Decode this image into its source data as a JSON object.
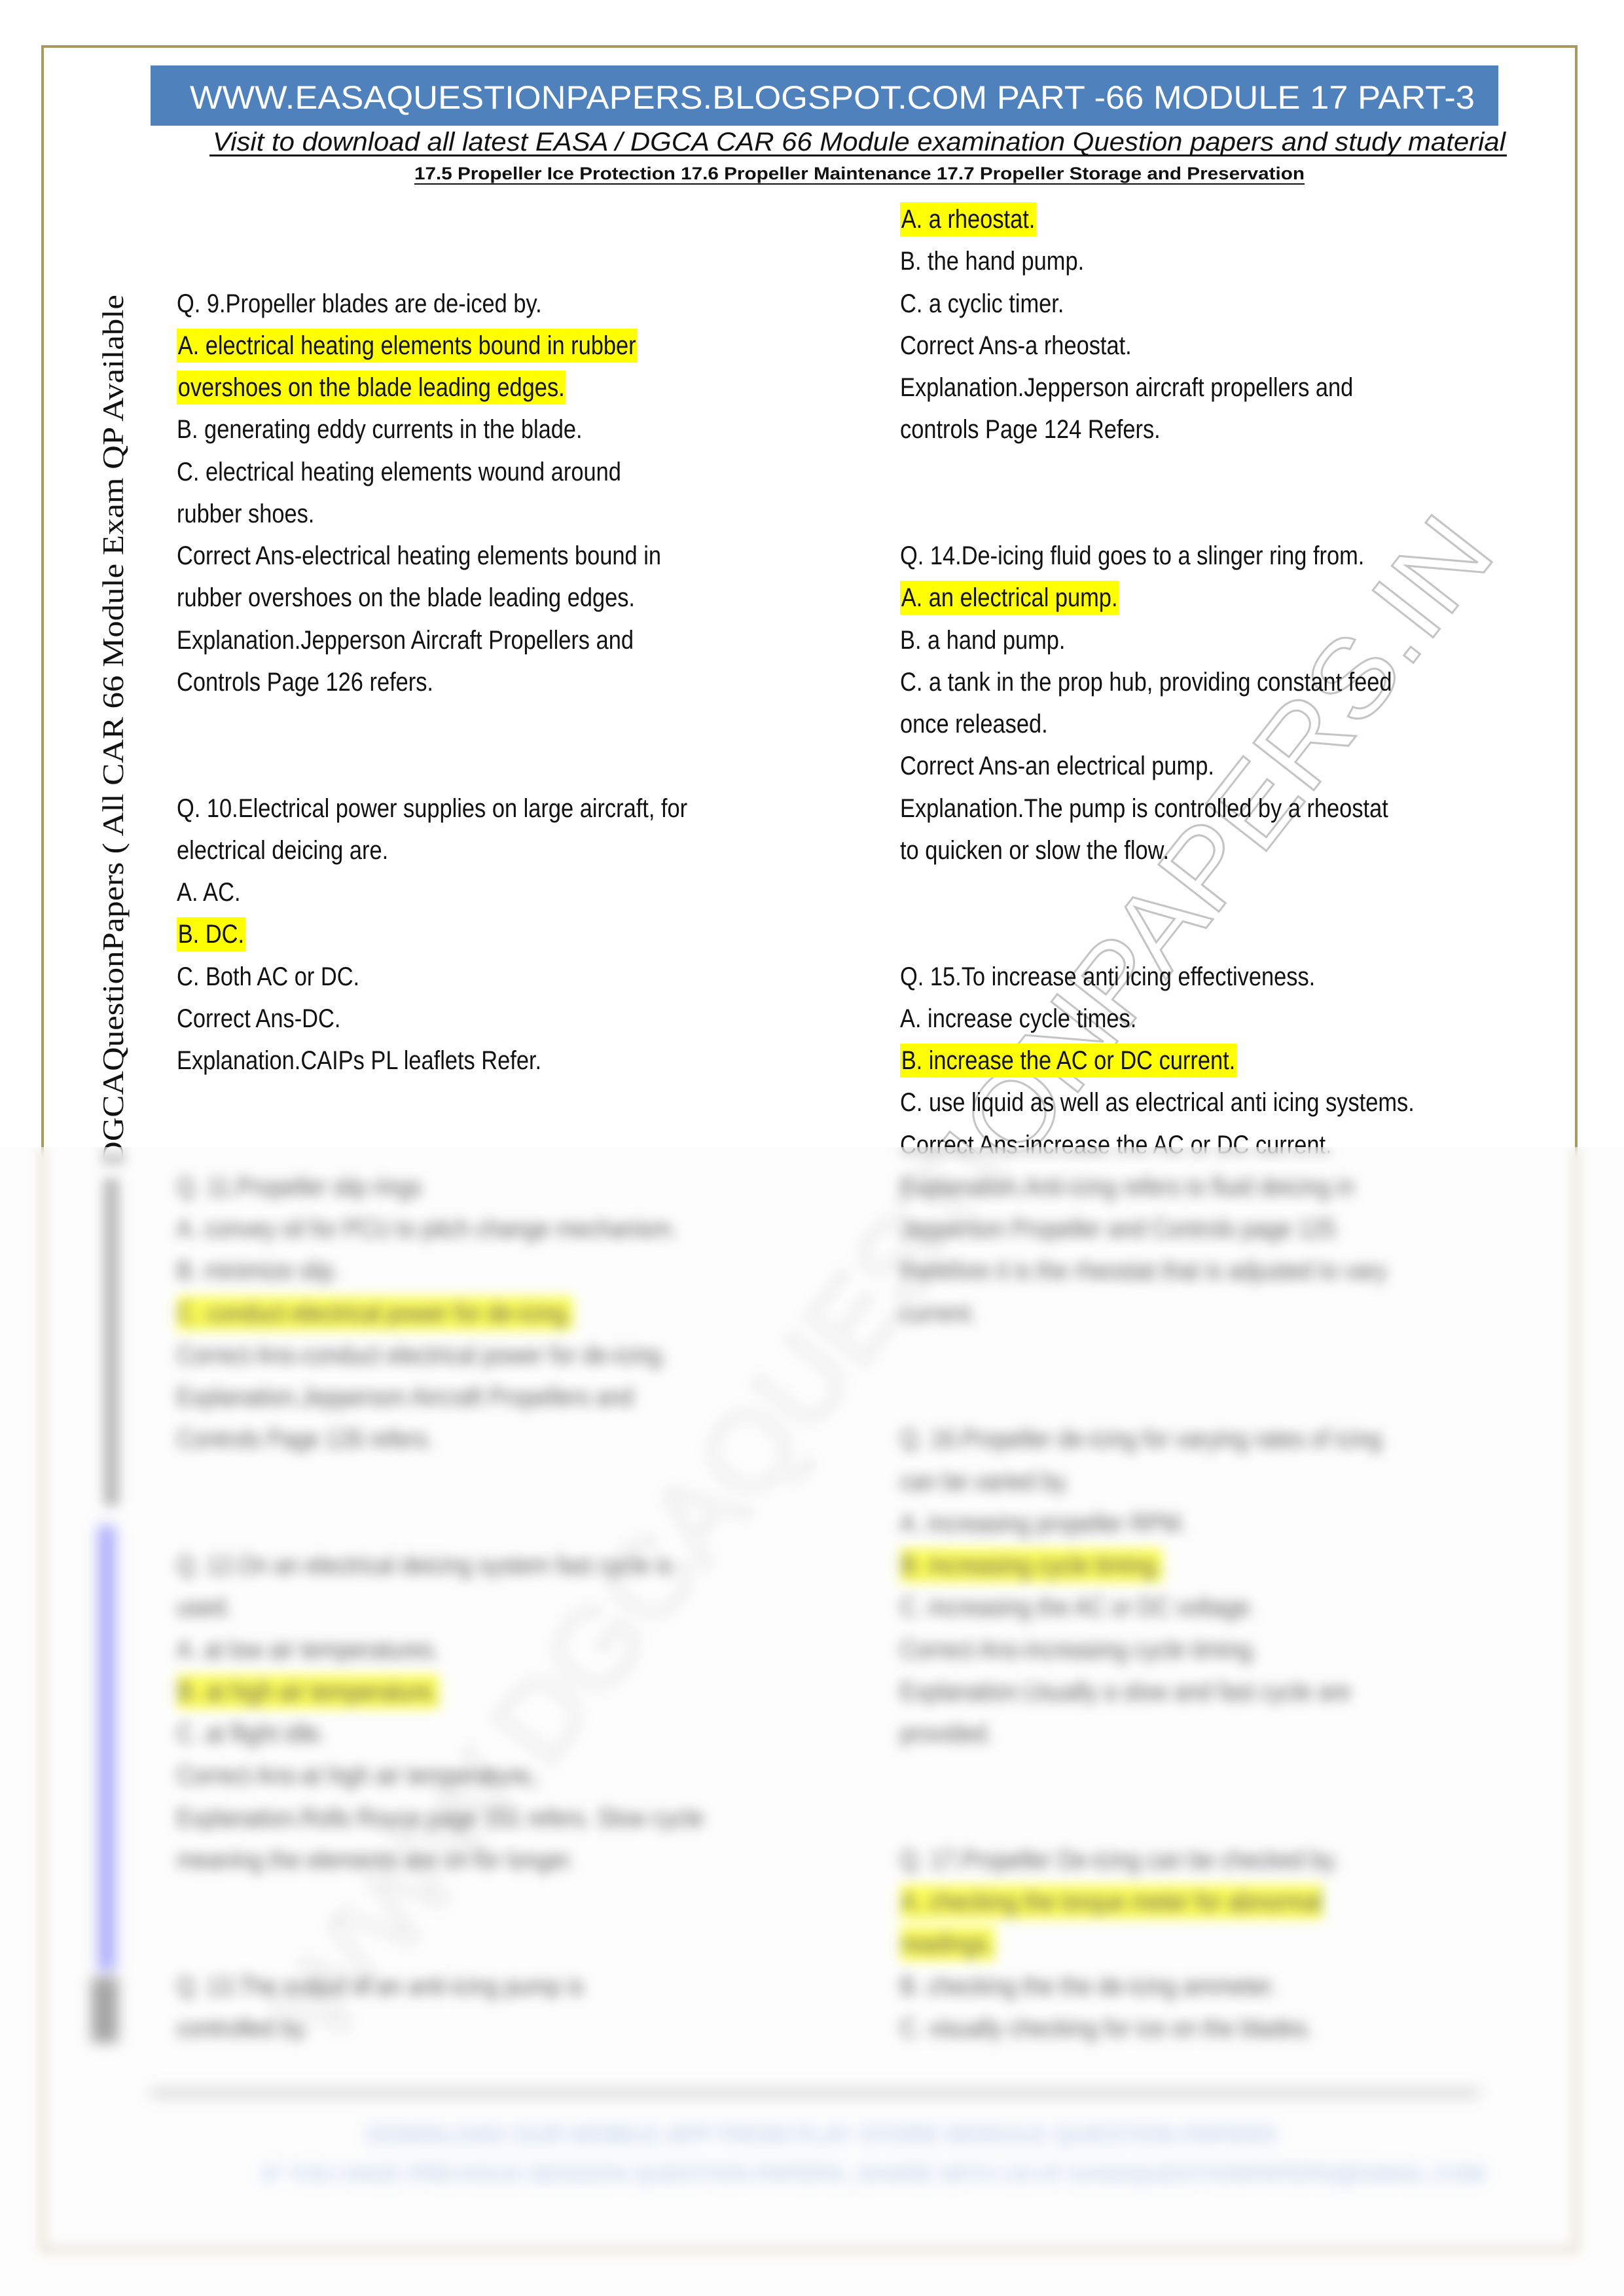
{
  "header": {
    "banner": "WWW.EASAQUESTIONPAPERS.BLOGSPOT.COM PART -66 MODULE 17 PART-3",
    "banner_color": "#4f81bd",
    "visit_line": "Visit to download all latest EASA / DGCA CAR 66 Module examination Question papers and study material",
    "topics": "17.5 Propeller Ice Protection 17.6 Propeller Maintenance 17.7 Propeller Storage and Preservation"
  },
  "sidebar_text": "DGCAQuestionPapers ( All CAR 66 Module Exam QP Available",
  "watermark": "WWW.DGCAQUESTIONPAPERS.IN",
  "highlight_color": "#ffff00",
  "left_column": [
    {
      "lines": [
        {
          "text": "Q. 9.Propeller blades are de-iced by."
        },
        {
          "text": "A. electrical heating elements bound in rubber",
          "hl": true
        },
        {
          "text": "overshoes on the blade leading edges.",
          "hl": true
        },
        {
          "text": "B. generating eddy currents in the blade."
        },
        {
          "text": "C. electrical heating elements wound around"
        },
        {
          "text": "rubber shoes."
        },
        {
          "text": "Correct Ans-electrical heating elements bound in"
        },
        {
          "text": "rubber overshoes on the blade leading edges."
        },
        {
          "text": "Explanation.Jepperson Aircraft Propellers and"
        },
        {
          "text": "Controls Page 126 refers."
        }
      ]
    },
    {
      "lines": [
        {
          "text": "Q. 10.Electrical power supplies on large aircraft, for"
        },
        {
          "text": "electrical deicing are."
        },
        {
          "text": "A. AC."
        },
        {
          "text": "B. DC.",
          "hl": true
        },
        {
          "text": "C. Both AC or DC."
        },
        {
          "text": "Correct Ans-DC."
        },
        {
          "text": "Explanation.CAIPs PL leaflets Refer."
        }
      ]
    },
    {
      "lines": [
        {
          "text": "Q. 11.Propeller slip rings"
        },
        {
          "text": "A. convey oil for PCU to pitch change mechanism."
        },
        {
          "text": "B. minimize slip."
        },
        {
          "text": "C. conduct electrical power for de-icing.",
          "hl": true
        },
        {
          "text": "Correct Ans-conduct electrical power for de-icing."
        },
        {
          "text": "Explanation.Jepperson Aircraft Propellers and"
        },
        {
          "text": "Controls Page 126 refers."
        }
      ]
    },
    {
      "lines": [
        {
          "text": "Q. 12.On an electrical deicing system fast cycle is"
        },
        {
          "text": "used."
        },
        {
          "text": "A. at low air temperatures."
        },
        {
          "text": "B. at high air temperature.",
          "hl": true
        },
        {
          "text": "C. at flight idle."
        },
        {
          "text": "Correct Ans-at high air temperature."
        },
        {
          "text": "Explanation.Rolls Royce page 151 refers. Slow cycle"
        },
        {
          "text": "meaning the elements are on for longer."
        }
      ]
    },
    {
      "lines": [
        {
          "text": "Q. 13.The output of an anti-icing pump is"
        },
        {
          "text": "controlled by."
        }
      ]
    }
  ],
  "right_column": [
    {
      "lines": [
        {
          "text": "A. a rheostat.",
          "hl": true
        },
        {
          "text": "B. the hand pump."
        },
        {
          "text": "C. a cyclic timer."
        },
        {
          "text": "Correct Ans-a rheostat."
        },
        {
          "text": "Explanation.Jepperson aircraft propellers and"
        },
        {
          "text": "controls Page 124 Refers."
        }
      ]
    },
    {
      "lines": [
        {
          "text": "Q. 14.De-icing fluid goes to a slinger ring from."
        },
        {
          "text": "A. an electrical pump.",
          "hl": true
        },
        {
          "text": "B. a hand pump."
        },
        {
          "text": "C. a tank in the prop hub, providing constant feed"
        },
        {
          "text": "once released."
        },
        {
          "text": "Correct Ans-an electrical pump."
        },
        {
          "text": "Explanation.The pump is controlled by a rheostat"
        },
        {
          "text": "to quicken or slow the flow."
        }
      ]
    },
    {
      "lines": [
        {
          "text": "Q. 15.To increase anti icing effectiveness."
        },
        {
          "text": "A. increase cycle times."
        },
        {
          "text": "B. increase the AC or DC current.",
          "hl": true
        },
        {
          "text": "C. use liquid as well as electrical anti icing systems."
        },
        {
          "text": "Correct Ans-increase the AC or DC current."
        },
        {
          "text": "Explanation.Anti-icing refers to fluid deicing in"
        },
        {
          "text": "Jepperson Propeller and Controls page 125"
        },
        {
          "text": "therefore it is the rheostat that is adjusted to vary"
        },
        {
          "text": "current."
        }
      ]
    },
    {
      "lines": [
        {
          "text": "Q. 16.Propeller de-icing for varying rates of icing"
        },
        {
          "text": "can be varied by."
        },
        {
          "text": "A. increasing propeller RPM."
        },
        {
          "text": "B. increasing cycle timing.",
          "hl": true
        },
        {
          "text": "C. increasing the AC or DC voltage."
        },
        {
          "text": "Correct Ans-increasing cycle timing."
        },
        {
          "text": "Explanation.Usually a slow and fast cycle are"
        },
        {
          "text": "provided."
        }
      ]
    },
    {
      "lines": [
        {
          "text": "Q. 17.Propeller De-icing can be checked by."
        },
        {
          "text": "A. checking the torque meter for abnormal",
          "hl": true
        },
        {
          "text": "readings.",
          "hl": true
        },
        {
          "text": "B. checking the the de-icing ammeter."
        },
        {
          "text": "C. visually checking for ice on the blades."
        }
      ]
    }
  ],
  "footer": {
    "line1": "DOWNLOAD OUR MOBILE APP FROM PLAY STORE MODULE QUESTION PAPERS",
    "line2": "IF YOU HAVE PREVIOUS SESSION QUESTION PAPERS, SHARE WITH US AT EASAQUESTIONPAPERS@GMAIL.COM",
    "link_color": "#7fa6dd"
  }
}
